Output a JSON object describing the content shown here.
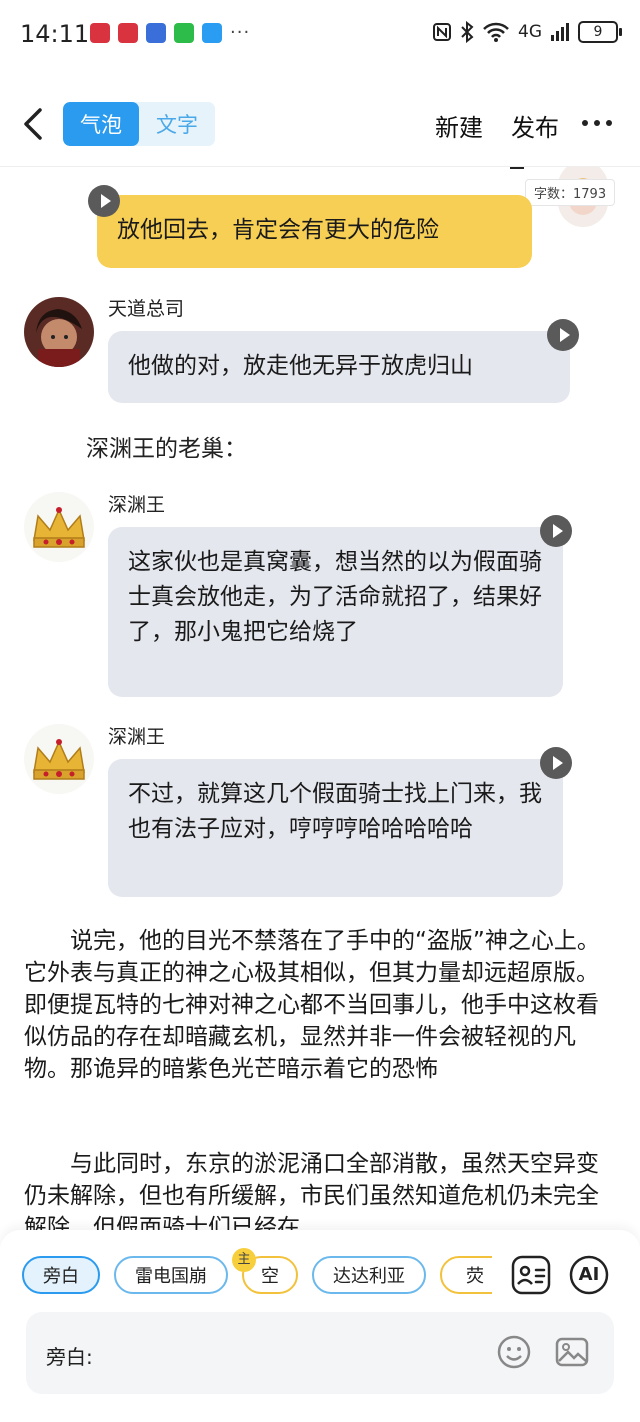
{
  "status_bar": {
    "time": "14:11",
    "notification_more": "···",
    "network": "4G",
    "battery": "9"
  },
  "nav": {
    "tabs": [
      {
        "label": "气泡",
        "active": true
      },
      {
        "label": "文字",
        "active": false
      }
    ],
    "new_label": "新建",
    "publish_label": "发布"
  },
  "editor": {
    "char_count": "字数：1793"
  },
  "messages": [
    {
      "sender": "",
      "text": "放他回去，肯定会有更大的危险",
      "style": "yellow",
      "side": "right"
    },
    {
      "sender": "天道总司",
      "text": "他做的对，放走他无异于放虎归山",
      "style": "grey",
      "side": "left"
    }
  ],
  "scene_label": "深渊王的老巢：",
  "messages2": [
    {
      "sender": "深渊王",
      "text": "这家伙也是真窝囊，想当然的以为假面骑士真会放他走，为了活命就招了，结果好了，那小鬼把它给烧了"
    },
    {
      "sender": "深渊王",
      "text": "不过，就算这几个假面骑士找上门来，我也有法子应对，哼哼哼哈哈哈哈哈"
    }
  ],
  "narration": [
    "说完，他的目光不禁落在了手中的“盗版”神之心上。它外表与真正的神之心极其相似，但其力量却远超原版。即便提瓦特的七神对神之心都不当回事儿，他手中这枚看似仿品的存在却暗藏玄机，显然并非一件会被轻视的凡物。那诡异的暗紫色光芒暗示着它的恐怖",
    "与此同时，东京的淤泥涌口全部消散，虽然天空异变仍未解除，但也有所缓解，市民们虽然知道危机仍未完全解除，但假面骑士们已经在"
  ],
  "bottom": {
    "chips": [
      "旁白",
      "雷电国崩",
      "空",
      "达达利亚",
      "荧"
    ],
    "main_tag": "主",
    "input_label": "旁白:",
    "ai_label": "AI"
  },
  "colors": {
    "accent": "#2b9bef",
    "bubble_grey": "#e4e7ee",
    "bubble_yellow": "#f7cf54"
  }
}
